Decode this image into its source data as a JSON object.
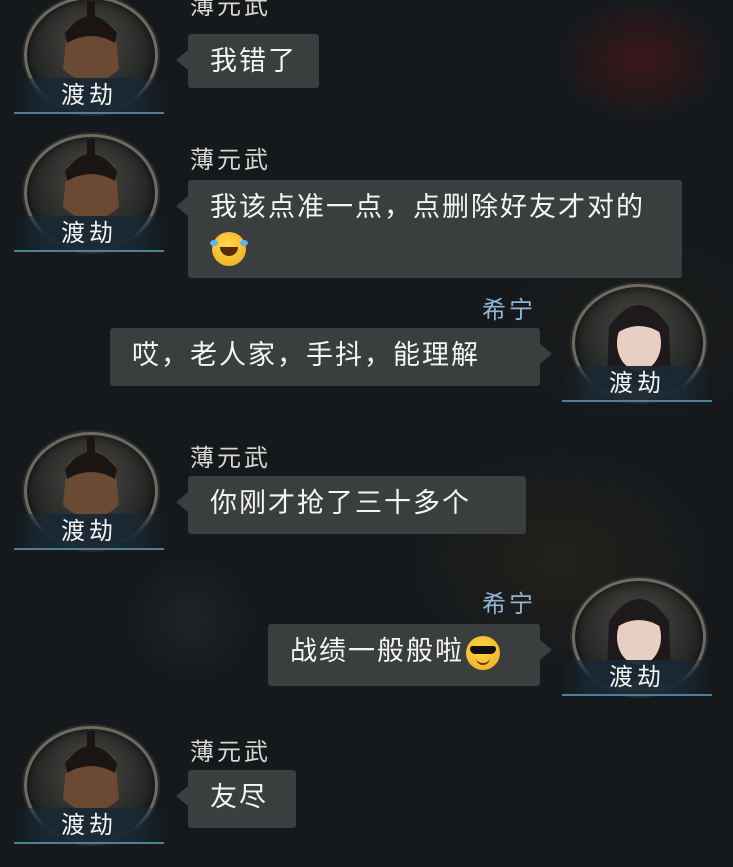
{
  "messages": [
    {
      "side": "left",
      "sender": "薄元武",
      "text": "我错了",
      "emoji": null,
      "avatar_label": "渡劫"
    },
    {
      "side": "left",
      "sender": "薄元武",
      "text": "我该点准一点，点删除好友才对的",
      "emoji": "face-with-tears-of-joy",
      "avatar_label": "渡劫"
    },
    {
      "side": "right",
      "sender": "希宁",
      "text": "哎，老人家，手抖，能理解",
      "emoji": null,
      "avatar_label": "渡劫"
    },
    {
      "side": "left",
      "sender": "薄元武",
      "text": "你刚才抢了三十多个",
      "emoji": null,
      "avatar_label": "渡劫"
    },
    {
      "side": "right",
      "sender": "希宁",
      "text": "战绩一般般啦",
      "emoji": "smiling-face-with-sunglasses",
      "avatar_label": "渡劫"
    },
    {
      "side": "left",
      "sender": "薄元武",
      "text": "友尽",
      "emoji": null,
      "avatar_label": "渡劫"
    }
  ],
  "colors": {
    "background": "#15191c",
    "bubble": "#3a3e3f",
    "sender_left": "#d8d8d0",
    "sender_right": "#8fb6d6",
    "nameplate_accent": "#4f7f9a"
  }
}
